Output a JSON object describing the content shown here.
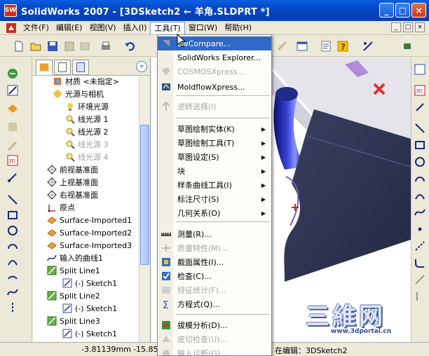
{
  "window": {
    "title": "SolidWorks 2007 - [3DSketch2 ← 羊角.SLDPRT *]",
    "app_icon_text": "SW",
    "minimize": "_",
    "maximize": "□",
    "close": "×"
  },
  "menubar": {
    "items": [
      "文件(F)",
      "编辑(E)",
      "视图(V)",
      "插入(I)",
      "工具(T)",
      "窗口(W)",
      "帮助(H)"
    ],
    "active_index": 4,
    "mdi": [
      "_",
      "□",
      "×"
    ]
  },
  "tree": {
    "expand_btn": "»",
    "items": [
      {
        "label": "材质 <未指定>",
        "icon": "material-icon",
        "dim": false
      },
      {
        "label": "光源与相机",
        "icon": "lights-icon",
        "dim": false
      },
      {
        "label": "环境光源",
        "icon": "ambient-light-icon",
        "dim": false
      },
      {
        "label": "线光源 1",
        "icon": "directional-light-icon",
        "dim": false
      },
      {
        "label": "线光源 2",
        "icon": "directional-light-icon",
        "dim": false
      },
      {
        "label": "线光源 3",
        "icon": "directional-light-icon",
        "dim": true
      },
      {
        "label": "线光源 4",
        "icon": "directional-light-icon",
        "dim": true
      },
      {
        "label": "前视基准面",
        "icon": "plane-icon",
        "dim": false
      },
      {
        "label": "上视基准面",
        "icon": "plane-icon",
        "dim": false
      },
      {
        "label": "右视基准面",
        "icon": "plane-icon",
        "dim": false
      },
      {
        "label": "原点",
        "icon": "origin-icon",
        "dim": false
      },
      {
        "label": "Surface-Imported1",
        "icon": "surface-icon",
        "dim": false
      },
      {
        "label": "Surface-Imported2",
        "icon": "surface-icon",
        "dim": false
      },
      {
        "label": "Surface-Imported3",
        "icon": "surface-icon",
        "dim": false
      },
      {
        "label": "输入的曲线1",
        "icon": "curve-icon",
        "dim": false
      },
      {
        "label": "Split Line1",
        "icon": "split-line-icon",
        "dim": false
      },
      {
        "label": "(-) Sketch1",
        "icon": "sketch-icon",
        "dim": false
      },
      {
        "label": "Split Line2",
        "icon": "split-line-icon",
        "dim": false
      },
      {
        "label": "(-) Sketch1",
        "icon": "sketch-icon",
        "dim": false
      },
      {
        "label": "Split Line3",
        "icon": "split-line-icon",
        "dim": false
      },
      {
        "label": "(-) Sketch1",
        "icon": "sketch-icon",
        "dim": false
      }
    ]
  },
  "tools_menu": {
    "items": [
      {
        "label": "CompareCompare...",
        "display": "awCompare...",
        "icon": "compare-icon",
        "state": "highlight"
      },
      {
        "label": "SolidWorks Explorer...",
        "icon": "",
        "state": "normal"
      },
      {
        "label": "COSMOSXpress...",
        "icon": "cosmos-icon",
        "state": "disabled"
      },
      {
        "label": "MoldflowXpress...",
        "icon": "moldflow-icon",
        "state": "normal"
      },
      {
        "label": "逆转选择(I)",
        "icon": "invert-select-icon",
        "state": "disabled"
      },
      {
        "label": "草图绘制实体(K)",
        "icon": "",
        "state": "normal",
        "submenu": true
      },
      {
        "label": "草图绘制工具(T)",
        "icon": "",
        "state": "normal",
        "submenu": true
      },
      {
        "label": "草图设定(S)",
        "icon": "",
        "state": "normal",
        "submenu": true
      },
      {
        "label": "块",
        "icon": "",
        "state": "normal",
        "submenu": true
      },
      {
        "label": "样条曲线工具(I)",
        "icon": "",
        "state": "normal",
        "submenu": true
      },
      {
        "label": "标注尺寸(S)",
        "icon": "",
        "state": "normal",
        "submenu": true
      },
      {
        "label": "几何关系(O)",
        "icon": "",
        "state": "normal",
        "submenu": true
      },
      {
        "label": "测量(R)...",
        "icon": "measure-icon",
        "state": "normal"
      },
      {
        "label": "质量特性(M)...",
        "icon": "mass-props-icon",
        "state": "disabled"
      },
      {
        "label": "截面属性(I)...",
        "icon": "section-props-icon",
        "state": "normal"
      },
      {
        "label": "检查(C)...",
        "icon": "check-icon",
        "state": "normal"
      },
      {
        "label": "特征统计(F)...",
        "icon": "feature-stats-icon",
        "state": "disabled"
      },
      {
        "label": "方程式(Q)...",
        "icon": "equation-icon",
        "state": "normal"
      },
      {
        "label": "拔模分析(D)...",
        "icon": "draft-analysis-icon",
        "state": "normal"
      },
      {
        "label": "底切检查(U)...",
        "icon": "undercut-icon",
        "state": "disabled"
      },
      {
        "label": "输入诊断(G)...",
        "icon": "import-diag-icon",
        "state": "disabled"
      }
    ]
  },
  "status": {
    "coord_x": "-3.81139mm",
    "coord_y": "-15.85",
    "mode": "在编辑：3DSketch2"
  },
  "watermark": {
    "big": "三維网",
    "url": "www.3dportal.cn"
  },
  "colors": {
    "title_bar": "#0a4ad0",
    "menu_highlight": "#3169c6",
    "model_surface": "#3a3f5c",
    "model_tube": "#20269a"
  }
}
